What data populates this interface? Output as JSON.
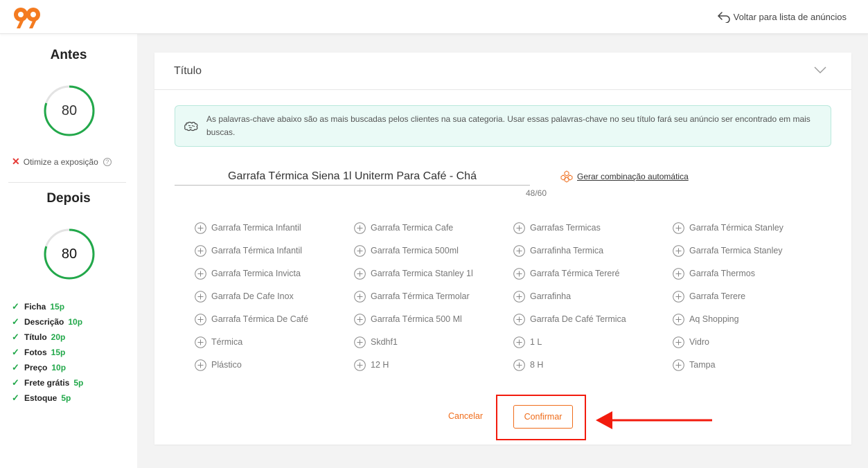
{
  "header": {
    "logo_icon": "99-logo-icon",
    "back_icon": "return-arrow-icon",
    "back_label": "Voltar para lista de anúncios"
  },
  "sidebar": {
    "before": {
      "title": "Antes",
      "score": "80",
      "progress": 0.8
    },
    "optimize": {
      "icon": "x-icon",
      "label": "Otimize a exposição",
      "help_icon": "help-circle-icon"
    },
    "after": {
      "title": "Depois",
      "score": "80",
      "progress": 0.8
    },
    "checklist": [
      {
        "label": "Ficha",
        "points": "15p"
      },
      {
        "label": "Descrição",
        "points": "10p"
      },
      {
        "label": "Título",
        "points": "20p"
      },
      {
        "label": "Fotos",
        "points": "15p"
      },
      {
        "label": "Preço",
        "points": "10p"
      },
      {
        "label": "Frete grátis",
        "points": "5p"
      },
      {
        "label": "Estoque",
        "points": "5p"
      }
    ],
    "check_icon": "checkmark-icon"
  },
  "card": {
    "title": "Título",
    "chevron_icon": "chevron-down-icon",
    "info": {
      "icon": "brain-icon",
      "text": "As palavras-chave abaixo são as mais buscadas pelos clientes na sua categoria. Usar essas palavras-chave no seu título fará seu anúncio ser encontrado em mais buscas."
    },
    "title_value": "Garrafa Térmica Siena 1l Uniterm Para Café - Chá",
    "counter": "48/60",
    "auto_generate": {
      "icon": "hexagon-cluster-icon",
      "label": "Gerar combinação automática"
    },
    "keywords": [
      "Garrafa Termica Infantil",
      "Garrafa Termica Cafe",
      "Garrafas Termicas",
      "Garrafa Térmica Stanley",
      "Garrafa Térmica Infantil",
      "Garrafa Termica 500ml",
      "Garrafinha Termica",
      "Garrafa Termica Stanley",
      "Garrafa Termica Invicta",
      "Garrafa Termica Stanley 1l",
      "Garrafa Térmica Tereré",
      "Garrafa Thermos",
      "Garrafa De Cafe Inox",
      "Garrafa Térmica Termolar",
      "Garrafinha",
      "Garrafa Terere",
      "Garrafa Térmica De Café",
      "Garrafa Térmica 500 Ml",
      "Garrafa De Café Termica",
      "Aq Shopping",
      "Térmica",
      "Skdhf1",
      "1 L",
      "Vidro",
      "Plástico",
      "12 H",
      "8 H",
      "Tampa"
    ],
    "keyword_icon": "plus-circle-icon",
    "cancel_label": "Cancelar",
    "confirm_label": "Confirmar"
  },
  "colors": {
    "accent": "#ef6c1a",
    "success": "#22a84a",
    "annotation": "#f21b0d",
    "info_bg": "#eafaf6"
  }
}
